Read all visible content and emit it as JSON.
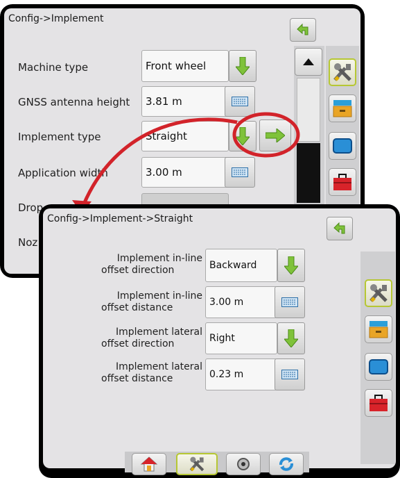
{
  "top_panel": {
    "title": "Config->Implement",
    "rows": [
      {
        "label": "Machine type",
        "value": "Front wheel",
        "control": "dropdown"
      },
      {
        "label": "GNSS antenna height",
        "value": "3.81 m",
        "control": "keyboard"
      },
      {
        "label": "Implement type",
        "value": "Straight",
        "control": "dropdown"
      },
      {
        "label": "Application width",
        "value": "3.00 m",
        "control": "keyboard"
      },
      {
        "label": "Drop to ground",
        "value": "",
        "control": "dropdown"
      },
      {
        "label": "Noz",
        "value": "",
        "control": "none"
      }
    ]
  },
  "bottom_panel": {
    "title": "Config->Implement->Straight",
    "rows": [
      {
        "label_line1": "Implement in-line",
        "label_line2": "offset direction",
        "value": "Backward",
        "control": "dropdown"
      },
      {
        "label_line1": "Implement in-line",
        "label_line2": "offset distance",
        "value": "3.00 m",
        "control": "keyboard"
      },
      {
        "label_line1": "Implement lateral",
        "label_line2": "offset direction",
        "value": "Right",
        "control": "dropdown"
      },
      {
        "label_line1": "Implement lateral",
        "label_line2": "offset distance",
        "value": "0.23 m",
        "control": "keyboard"
      }
    ]
  },
  "icons": {
    "back": "back-arrow-icon",
    "dropdown": "green-down-arrow-icon",
    "keyboard": "keyboard-icon",
    "next": "green-right-arrow-icon",
    "tools": "tools-icon",
    "drawer": "drawer-icon",
    "screen": "screen-icon",
    "toolbox": "toolbox-icon",
    "home": "home-icon",
    "settings": "settings-icon",
    "cycle": "cycle-icon"
  },
  "colors": {
    "accent_green": "#7fc23a",
    "callout_red": "#d2232a",
    "panel_bg": "#e4e3e5",
    "frame": "#000000"
  }
}
